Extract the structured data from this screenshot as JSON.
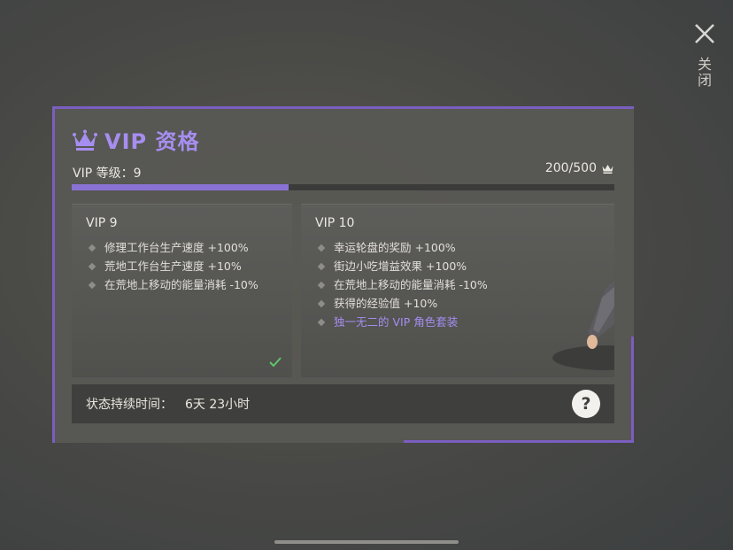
{
  "close": {
    "label": "关闭",
    "icon": "close-icon"
  },
  "dialog": {
    "title": "VIP 资格",
    "title_icon": "crown-icon",
    "level_label": "VIP 等级：9",
    "points": "200/500",
    "progress_fraction": 0.4,
    "accent_color": "#8a72d4",
    "current_tier": {
      "title": "VIP 9",
      "benefits": [
        "修理工作台生产速度 +100%",
        "荒地工作台生产速度 +10%",
        "在荒地上移动的能量消耗 -10%"
      ],
      "status_icon": "check-icon"
    },
    "next_tier": {
      "title": "VIP 10",
      "benefits": [
        "幸运轮盘的奖励 +100%",
        "街边小吃增益效果 +100%",
        "在荒地上移动的能量消耗 -10%",
        "获得的经验值 +10%"
      ],
      "special_benefit": "独一无二的 VIP 角色套装"
    },
    "status": {
      "label": "状态持续时间：",
      "value": "6天 23小时",
      "help_label": "?"
    }
  }
}
